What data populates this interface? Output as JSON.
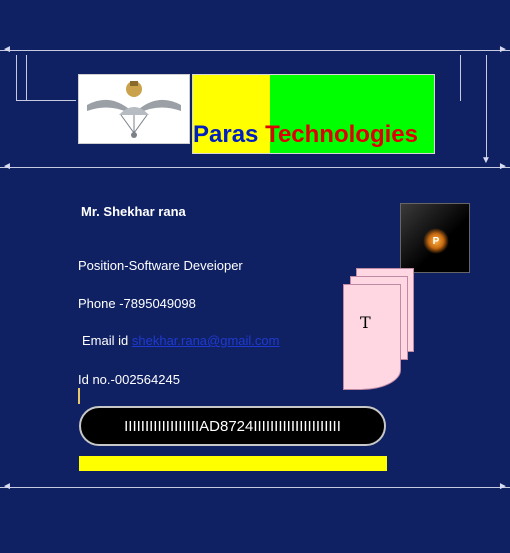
{
  "brand": {
    "word1": "Paras",
    "word2": "Technologies",
    "tile_letter": "P"
  },
  "card": {
    "name": "Mr. Shekhar rana",
    "position_label": "Position-Software Deveioper",
    "phone_label": "Phone  -7895049098",
    "email_label": "Email id",
    "email_value": "shekhar.rana@gmail.com",
    "id_label": "Id no.-002564245",
    "barcode_text": "IIIIIIIIIIIIIIIIIIAD8724IIIIIIIIIIIIIIIIIIIII",
    "sheet_letter": "T"
  },
  "colors": {
    "background": "#102163",
    "brand_yellow": "#ffff00",
    "brand_green": "#00ff00",
    "brand_blue": "#0020c0",
    "brand_red": "#e00000"
  }
}
